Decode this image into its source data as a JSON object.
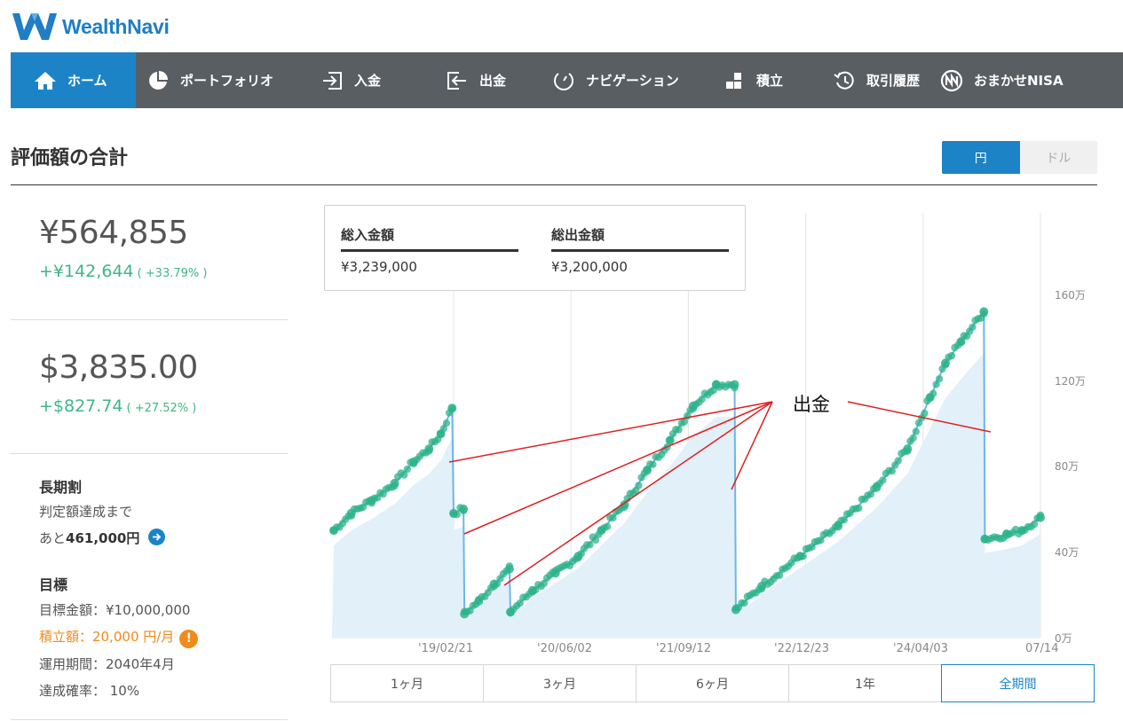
{
  "brand": {
    "name": "WealthNavi",
    "color": "#1f7ec6"
  },
  "nav": {
    "items": [
      {
        "label": "ホーム",
        "icon": "home-icon",
        "active": true
      },
      {
        "label": "ポートフォリオ",
        "icon": "pie-chart-icon"
      },
      {
        "label": "入金",
        "icon": "deposit-icon"
      },
      {
        "label": "出金",
        "icon": "withdraw-icon"
      },
      {
        "label": "ナビゲーション",
        "icon": "gauge-icon"
      },
      {
        "label": "積立",
        "icon": "blocks-icon"
      },
      {
        "label": "取引履歴",
        "icon": "history-icon"
      },
      {
        "label": "おまかせNISA",
        "icon": "nisa-icon"
      }
    ]
  },
  "summary": {
    "title": "評価額の合計",
    "currency_toggle": {
      "yen": "円",
      "dollar": "ドル",
      "selected": "円"
    },
    "jpy": {
      "value": "¥564,855",
      "gain": "+¥142,644",
      "gain_pct": "( +33.79% )"
    },
    "usd": {
      "value": "$3,835.00",
      "gain": "+$827.74",
      "gain_pct": "( +27.52% )"
    }
  },
  "long_term": {
    "heading": "長期割",
    "line1": "判定額達成まで",
    "line2_prefix": "あと",
    "line2_amount": "461,000円",
    "icon": "arrow-right-icon"
  },
  "goal": {
    "heading": "目標",
    "target": "目標金額：¥10,000,000",
    "monthly": "積立額：20,000 円/月",
    "period": "運用期間：2040年4月",
    "probability": "達成確率： 10%",
    "warning_icon": "exclamation-icon"
  },
  "totals": {
    "deposit_label": "総入金額",
    "deposit_value": "¥3,239,000",
    "withdraw_label": "総出金額",
    "withdraw_value": "¥3,200,000"
  },
  "annotation": {
    "text": "出金",
    "color": "#e02020"
  },
  "periods": {
    "options": [
      "1ヶ月",
      "3ヶ月",
      "6ヶ月",
      "1年",
      "全期間"
    ],
    "selected": "全期間"
  },
  "colors": {
    "accent": "#1c84c6",
    "gain": "#3fb685",
    "nav_bg": "#595e63",
    "point": "#2db38a",
    "area": "#e2f0f9",
    "line": "#6cb6e8"
  },
  "chart_data": {
    "type": "area",
    "y_unit": "万",
    "y_ticks": [
      "160万",
      "120万",
      "80万",
      "40万",
      "0万"
    ],
    "ylim": [
      0,
      160
    ],
    "x_ticks": [
      "'19/02/21",
      "'20/06/02",
      "'21/09/12",
      "'22/12/23",
      "'24/04/03",
      "07/14"
    ],
    "series": [
      {
        "values": [
          {
            "x": "2017-11-01",
            "y": 50
          },
          {
            "x": "2018-01-10",
            "y": 58
          },
          {
            "x": "2018-04-01",
            "y": 64
          },
          {
            "x": "2018-07-01",
            "y": 72
          },
          {
            "x": "2018-09-15",
            "y": 82
          },
          {
            "x": "2018-11-15",
            "y": 88
          },
          {
            "x": "2019-01-01",
            "y": 95
          },
          {
            "x": "2019-02-15",
            "y": 107
          },
          {
            "x": "2019-02-21",
            "y": 58
          },
          {
            "x": "2019-04-01",
            "y": 60
          },
          {
            "x": "2019-04-05",
            "y": 11
          },
          {
            "x": "2019-06-01",
            "y": 17
          },
          {
            "x": "2019-08-01",
            "y": 25
          },
          {
            "x": "2019-10-01",
            "y": 32
          },
          {
            "x": "2019-10-05",
            "y": 12
          },
          {
            "x": "2020-01-01",
            "y": 22
          },
          {
            "x": "2020-04-01",
            "y": 30
          },
          {
            "x": "2020-07-01",
            "y": 38
          },
          {
            "x": "2020-10-01",
            "y": 50
          },
          {
            "x": "2021-01-01",
            "y": 62
          },
          {
            "x": "2021-04-01",
            "y": 78
          },
          {
            "x": "2021-07-01",
            "y": 92
          },
          {
            "x": "2021-10-01",
            "y": 108
          },
          {
            "x": "2022-01-01",
            "y": 118
          },
          {
            "x": "2022-03-15",
            "y": 118
          },
          {
            "x": "2022-03-20",
            "y": 13
          },
          {
            "x": "2022-07-01",
            "y": 24
          },
          {
            "x": "2022-12-01",
            "y": 38
          },
          {
            "x": "2023-05-01",
            "y": 52
          },
          {
            "x": "2023-10-01",
            "y": 70
          },
          {
            "x": "2024-02-01",
            "y": 88
          },
          {
            "x": "2024-05-01",
            "y": 112
          },
          {
            "x": "2024-07-01",
            "y": 128
          },
          {
            "x": "2024-09-01",
            "y": 138
          },
          {
            "x": "2024-12-01",
            "y": 152
          },
          {
            "x": "2024-12-05",
            "y": 46
          },
          {
            "x": "2025-03-01",
            "y": 48
          },
          {
            "x": "2025-05-01",
            "y": 50
          },
          {
            "x": "2025-07-14",
            "y": 56
          }
        ]
      }
    ]
  }
}
